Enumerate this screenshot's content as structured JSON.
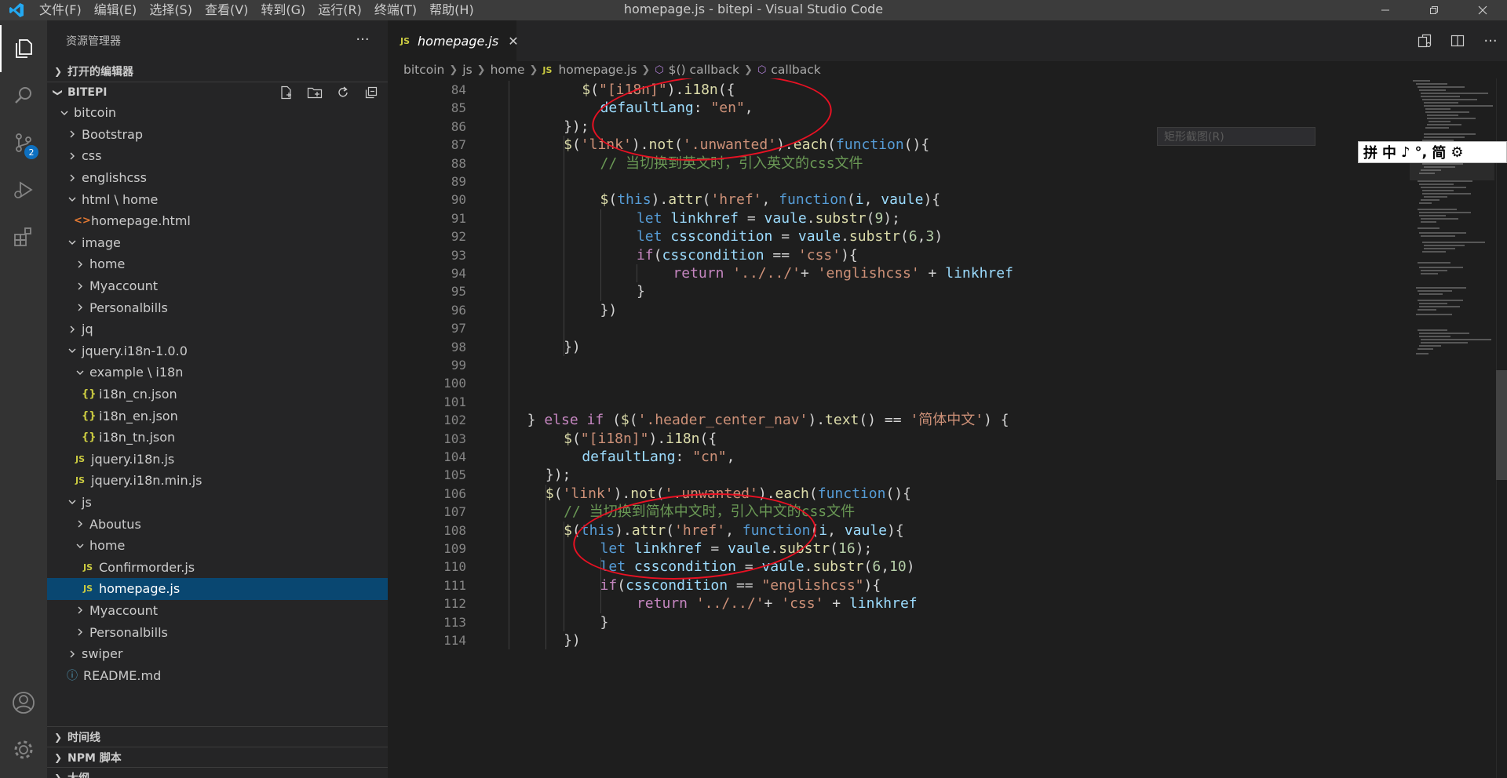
{
  "window": {
    "title": "homepage.js - bitepi - Visual Studio Code",
    "menu": [
      "文件(F)",
      "编辑(E)",
      "选择(S)",
      "查看(V)",
      "转到(G)",
      "运行(R)",
      "终端(T)",
      "帮助(H)"
    ]
  },
  "activity": {
    "scm_badge": "2"
  },
  "sidebar": {
    "header": "资源管理器",
    "more": "···",
    "open_editors": "打开的编辑器",
    "project": "BITEPI",
    "tree": [
      {
        "label": "bitcoin",
        "indent": 1,
        "type": "folder",
        "open": true
      },
      {
        "label": "Bootstrap",
        "indent": 2,
        "type": "folder",
        "open": false
      },
      {
        "label": "css",
        "indent": 2,
        "type": "folder",
        "open": false
      },
      {
        "label": "englishcss",
        "indent": 2,
        "type": "folder",
        "open": false
      },
      {
        "label": "html \\ home",
        "indent": 2,
        "type": "folder",
        "open": true
      },
      {
        "label": "homepage.html",
        "indent": 3,
        "type": "html"
      },
      {
        "label": "image",
        "indent": 2,
        "type": "folder",
        "open": true
      },
      {
        "label": "home",
        "indent": 3,
        "type": "folder",
        "open": false
      },
      {
        "label": "Myaccount",
        "indent": 3,
        "type": "folder",
        "open": false
      },
      {
        "label": "Personalbills",
        "indent": 3,
        "type": "folder",
        "open": false
      },
      {
        "label": "jq",
        "indent": 2,
        "type": "folder",
        "open": false
      },
      {
        "label": "jquery.i18n-1.0.0",
        "indent": 2,
        "type": "folder",
        "open": true
      },
      {
        "label": "example \\ i18n",
        "indent": 3,
        "type": "folder",
        "open": true
      },
      {
        "label": "i18n_cn.json",
        "indent": 4,
        "type": "json"
      },
      {
        "label": "i18n_en.json",
        "indent": 4,
        "type": "json"
      },
      {
        "label": "i18n_tn.json",
        "indent": 4,
        "type": "json"
      },
      {
        "label": "jquery.i18n.js",
        "indent": 3,
        "type": "js"
      },
      {
        "label": "jquery.i18n.min.js",
        "indent": 3,
        "type": "js"
      },
      {
        "label": "js",
        "indent": 2,
        "type": "folder",
        "open": true
      },
      {
        "label": "Aboutus",
        "indent": 3,
        "type": "folder",
        "open": false
      },
      {
        "label": "home",
        "indent": 3,
        "type": "folder",
        "open": true
      },
      {
        "label": "Confirmorder.js",
        "indent": 4,
        "type": "js"
      },
      {
        "label": "homepage.js",
        "indent": 4,
        "type": "js",
        "selected": true
      },
      {
        "label": "Myaccount",
        "indent": 3,
        "type": "folder",
        "open": false
      },
      {
        "label": "Personalbills",
        "indent": 3,
        "type": "folder",
        "open": false
      },
      {
        "label": "swiper",
        "indent": 2,
        "type": "folder",
        "open": false
      },
      {
        "label": "README.md",
        "indent": 2,
        "type": "md"
      }
    ],
    "bottom_sections": [
      "时间线",
      "NPM 脚本",
      "大纲"
    ]
  },
  "tab": {
    "label": "homepage.js",
    "icon": "JS",
    "close": "✕"
  },
  "breadcrumbs": [
    "bitcoin",
    "js",
    "home",
    "homepage.js",
    "$() callback",
    "callback"
  ],
  "editor": {
    "lines": [
      {
        "n": "84",
        "indent": 6,
        "html": "<span class=\"f\">$</span><span class=\"p\">(</span><span class=\"s\">\"[i18n]\"</span><span class=\"p\">).</span><span class=\"f\">i18n</span><span class=\"p\">({</span>"
      },
      {
        "n": "85",
        "indent": 7,
        "html": "<span class=\"v\">defaultLang</span><span class=\"p\">: </span><span class=\"s\">\"en\"</span><span class=\"p\">,</span>"
      },
      {
        "n": "86",
        "indent": 5,
        "html": "<span class=\"p\">});</span>"
      },
      {
        "n": "87",
        "indent": 5,
        "html": "<span class=\"f\">$</span><span class=\"p\">(</span><span class=\"s\">'link'</span><span class=\"p\">).</span><span class=\"f\">not</span><span class=\"p\">(</span><span class=\"s\">'.unwanted'</span><span class=\"p\">).</span><span class=\"f\">each</span><span class=\"p\">(</span><span class=\"kb\">function</span><span class=\"p\">(){</span>"
      },
      {
        "n": "88",
        "indent": 7,
        "html": "<span class=\"c\">// 当切换到英文时，引入英文的css文件</span>"
      },
      {
        "n": "89",
        "indent": 0,
        "html": ""
      },
      {
        "n": "90",
        "indent": 7,
        "html": "<span class=\"f\">$</span><span class=\"p\">(</span><span class=\"kb\">this</span><span class=\"p\">).</span><span class=\"f\">attr</span><span class=\"p\">(</span><span class=\"s\">'href'</span><span class=\"p\">, </span><span class=\"kb\">function</span><span class=\"p\">(</span><span class=\"v\">i</span><span class=\"p\">, </span><span class=\"v\">vaule</span><span class=\"p\">){</span>"
      },
      {
        "n": "91",
        "indent": 9,
        "html": "<span class=\"kb\">let</span> <span class=\"v\">linkhref</span><span class=\"p\"> = </span><span class=\"v\">vaule</span><span class=\"p\">.</span><span class=\"f\">substr</span><span class=\"p\">(</span><span class=\"n\">9</span><span class=\"p\">);</span>"
      },
      {
        "n": "92",
        "indent": 9,
        "html": "<span class=\"kb\">let</span> <span class=\"v\">csscondition</span><span class=\"p\"> = </span><span class=\"v\">vaule</span><span class=\"p\">.</span><span class=\"f\">substr</span><span class=\"p\">(</span><span class=\"n\">6</span><span class=\"p\">,</span><span class=\"n\">3</span><span class=\"p\">)</span>"
      },
      {
        "n": "93",
        "indent": 9,
        "html": "<span class=\"k\">if</span><span class=\"p\">(</span><span class=\"v\">csscondition</span><span class=\"p\"> == </span><span class=\"s\">'css'</span><span class=\"p\">){</span>"
      },
      {
        "n": "94",
        "indent": 11,
        "html": "<span class=\"k\">return</span> <span class=\"s\">'../../'</span><span class=\"p\">+ </span><span class=\"s\">'englishcss'</span><span class=\"p\"> + </span><span class=\"v\">linkhref</span>"
      },
      {
        "n": "95",
        "indent": 9,
        "html": "<span class=\"p\">}</span>"
      },
      {
        "n": "96",
        "indent": 7,
        "html": "<span class=\"p\">})</span>"
      },
      {
        "n": "97",
        "indent": 0,
        "html": ""
      },
      {
        "n": "98",
        "indent": 5,
        "html": "<span class=\"p\">})</span>"
      },
      {
        "n": "99",
        "indent": 0,
        "html": ""
      },
      {
        "n": "100",
        "indent": 0,
        "html": ""
      },
      {
        "n": "101",
        "indent": 0,
        "html": ""
      },
      {
        "n": "102",
        "indent": 3,
        "html": "<span class=\"p\">} </span><span class=\"k\">else</span> <span class=\"k\">if</span><span class=\"p\"> (</span><span class=\"f\">$</span><span class=\"p\">(</span><span class=\"s\">'.header_center_nav'</span><span class=\"p\">).</span><span class=\"f\">text</span><span class=\"p\">() == </span><span class=\"s\">'简体中文'</span><span class=\"p\">) {</span>"
      },
      {
        "n": "103",
        "indent": 5,
        "html": "<span class=\"f\">$</span><span class=\"p\">(</span><span class=\"s\">\"[i18n]\"</span><span class=\"p\">).</span><span class=\"f\">i18n</span><span class=\"p\">({</span>"
      },
      {
        "n": "104",
        "indent": 6,
        "html": "<span class=\"v\">defaultLang</span><span class=\"p\">: </span><span class=\"s\">\"cn\"</span><span class=\"p\">,</span>"
      },
      {
        "n": "105",
        "indent": 4,
        "html": "<span class=\"p\">});</span>"
      },
      {
        "n": "106",
        "indent": 4,
        "html": "<span class=\"f\">$</span><span class=\"p\">(</span><span class=\"s\">'link'</span><span class=\"p\">).</span><span class=\"f\">not</span><span class=\"p\">(</span><span class=\"s\">'.unwanted'</span><span class=\"p\">).</span><span class=\"f\">each</span><span class=\"p\">(</span><span class=\"kb\">function</span><span class=\"p\">(){</span>"
      },
      {
        "n": "107",
        "indent": 5,
        "html": "<span class=\"c\">// 当切换到简体中文时，引入中文的css文件</span>"
      },
      {
        "n": "108",
        "indent": 5,
        "html": "<span class=\"f\">$</span><span class=\"p\">(</span><span class=\"kb\">this</span><span class=\"p\">).</span><span class=\"f\">attr</span><span class=\"p\">(</span><span class=\"s\">'href'</span><span class=\"p\">, </span><span class=\"kb\">function</span><span class=\"p\">(</span><span class=\"v\">i</span><span class=\"p\">, </span><span class=\"v\">vaule</span><span class=\"p\">){</span>"
      },
      {
        "n": "109",
        "indent": 7,
        "html": "<span class=\"kb\">let</span> <span class=\"v\">linkhref</span><span class=\"p\"> = </span><span class=\"v\">vaule</span><span class=\"p\">.</span><span class=\"f\">substr</span><span class=\"p\">(</span><span class=\"n\">16</span><span class=\"p\">);</span>"
      },
      {
        "n": "110",
        "indent": 7,
        "html": "<span class=\"kb\">let</span> <span class=\"v\">csscondition</span><span class=\"p\"> = </span><span class=\"v\">vaule</span><span class=\"p\">.</span><span class=\"f\">substr</span><span class=\"p\">(</span><span class=\"n\">6</span><span class=\"p\">,</span><span class=\"n\">10</span><span class=\"p\">)</span>"
      },
      {
        "n": "111",
        "indent": 7,
        "html": "<span class=\"k\">if</span><span class=\"p\">(</span><span class=\"v\">csscondition</span><span class=\"p\"> == </span><span class=\"s\">\"englishcss\"</span><span class=\"p\">){</span>"
      },
      {
        "n": "112",
        "indent": 9,
        "html": "<span class=\"k\">return</span> <span class=\"s\">'../../'</span><span class=\"p\">+ </span><span class=\"s\">'css'</span><span class=\"p\"> + </span><span class=\"v\">linkhref</span>"
      },
      {
        "n": "113",
        "indent": 7,
        "html": "<span class=\"p\">}</span>"
      },
      {
        "n": "114",
        "indent": 5,
        "html": "<span class=\"p\">})</span>"
      }
    ]
  },
  "overlays": {
    "tooltip": "矩形截图(R)",
    "ime": [
      "拼",
      "中",
      "♪",
      "°,",
      "简",
      "⚙"
    ]
  }
}
